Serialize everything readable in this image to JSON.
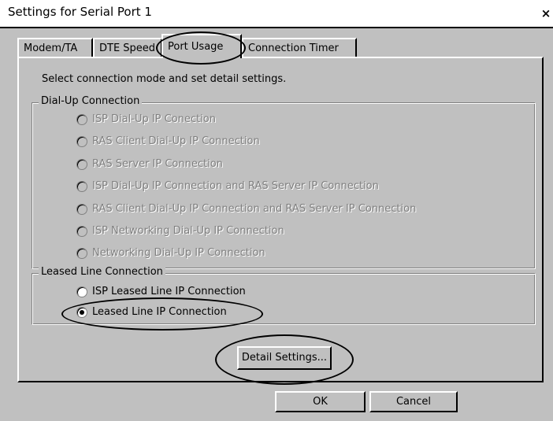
{
  "window": {
    "title": "Settings for Serial Port 1",
    "close_glyph": "×"
  },
  "tabs": [
    {
      "label": "Modem/TA"
    },
    {
      "label": "DTE Speed"
    },
    {
      "label": "Port Usage",
      "active": true
    },
    {
      "label": "Connection Timer"
    }
  ],
  "instruction": "Select connection mode and set detail settings.",
  "dialup": {
    "title": "Dial-Up Connection",
    "options": [
      {
        "label": "ISP Dial-Up IP Conection",
        "enabled": false,
        "selected": false
      },
      {
        "label": "RAS Client Dial-Up IP Connection",
        "enabled": false,
        "selected": false
      },
      {
        "label": "RAS Server IP Connection",
        "enabled": false,
        "selected": false
      },
      {
        "label": "ISP Dial-Up IP Connection and RAS Server IP Connection",
        "enabled": false,
        "selected": false
      },
      {
        "label": "RAS Client Dial-Up IP Connection and RAS Server IP Connection",
        "enabled": false,
        "selected": false
      },
      {
        "label": "ISP Networking Dial-Up IP Connection",
        "enabled": false,
        "selected": false
      },
      {
        "label": "Networking Dial-Up IP Connection",
        "enabled": false,
        "selected": false
      }
    ]
  },
  "leased": {
    "title": "Leased Line Connection",
    "options": [
      {
        "label": "ISP Leased Line IP Connection",
        "enabled": true,
        "selected": false
      },
      {
        "label": "Leased Line IP Connection",
        "enabled": true,
        "selected": true
      }
    ]
  },
  "buttons": {
    "detail": "Detail Settings...",
    "ok": "OK",
    "cancel": "Cancel"
  },
  "colors": {
    "face": "#c0c0c0",
    "disabled_text": "#808080",
    "highlight": "#ffffff",
    "shadow": "#000000"
  }
}
